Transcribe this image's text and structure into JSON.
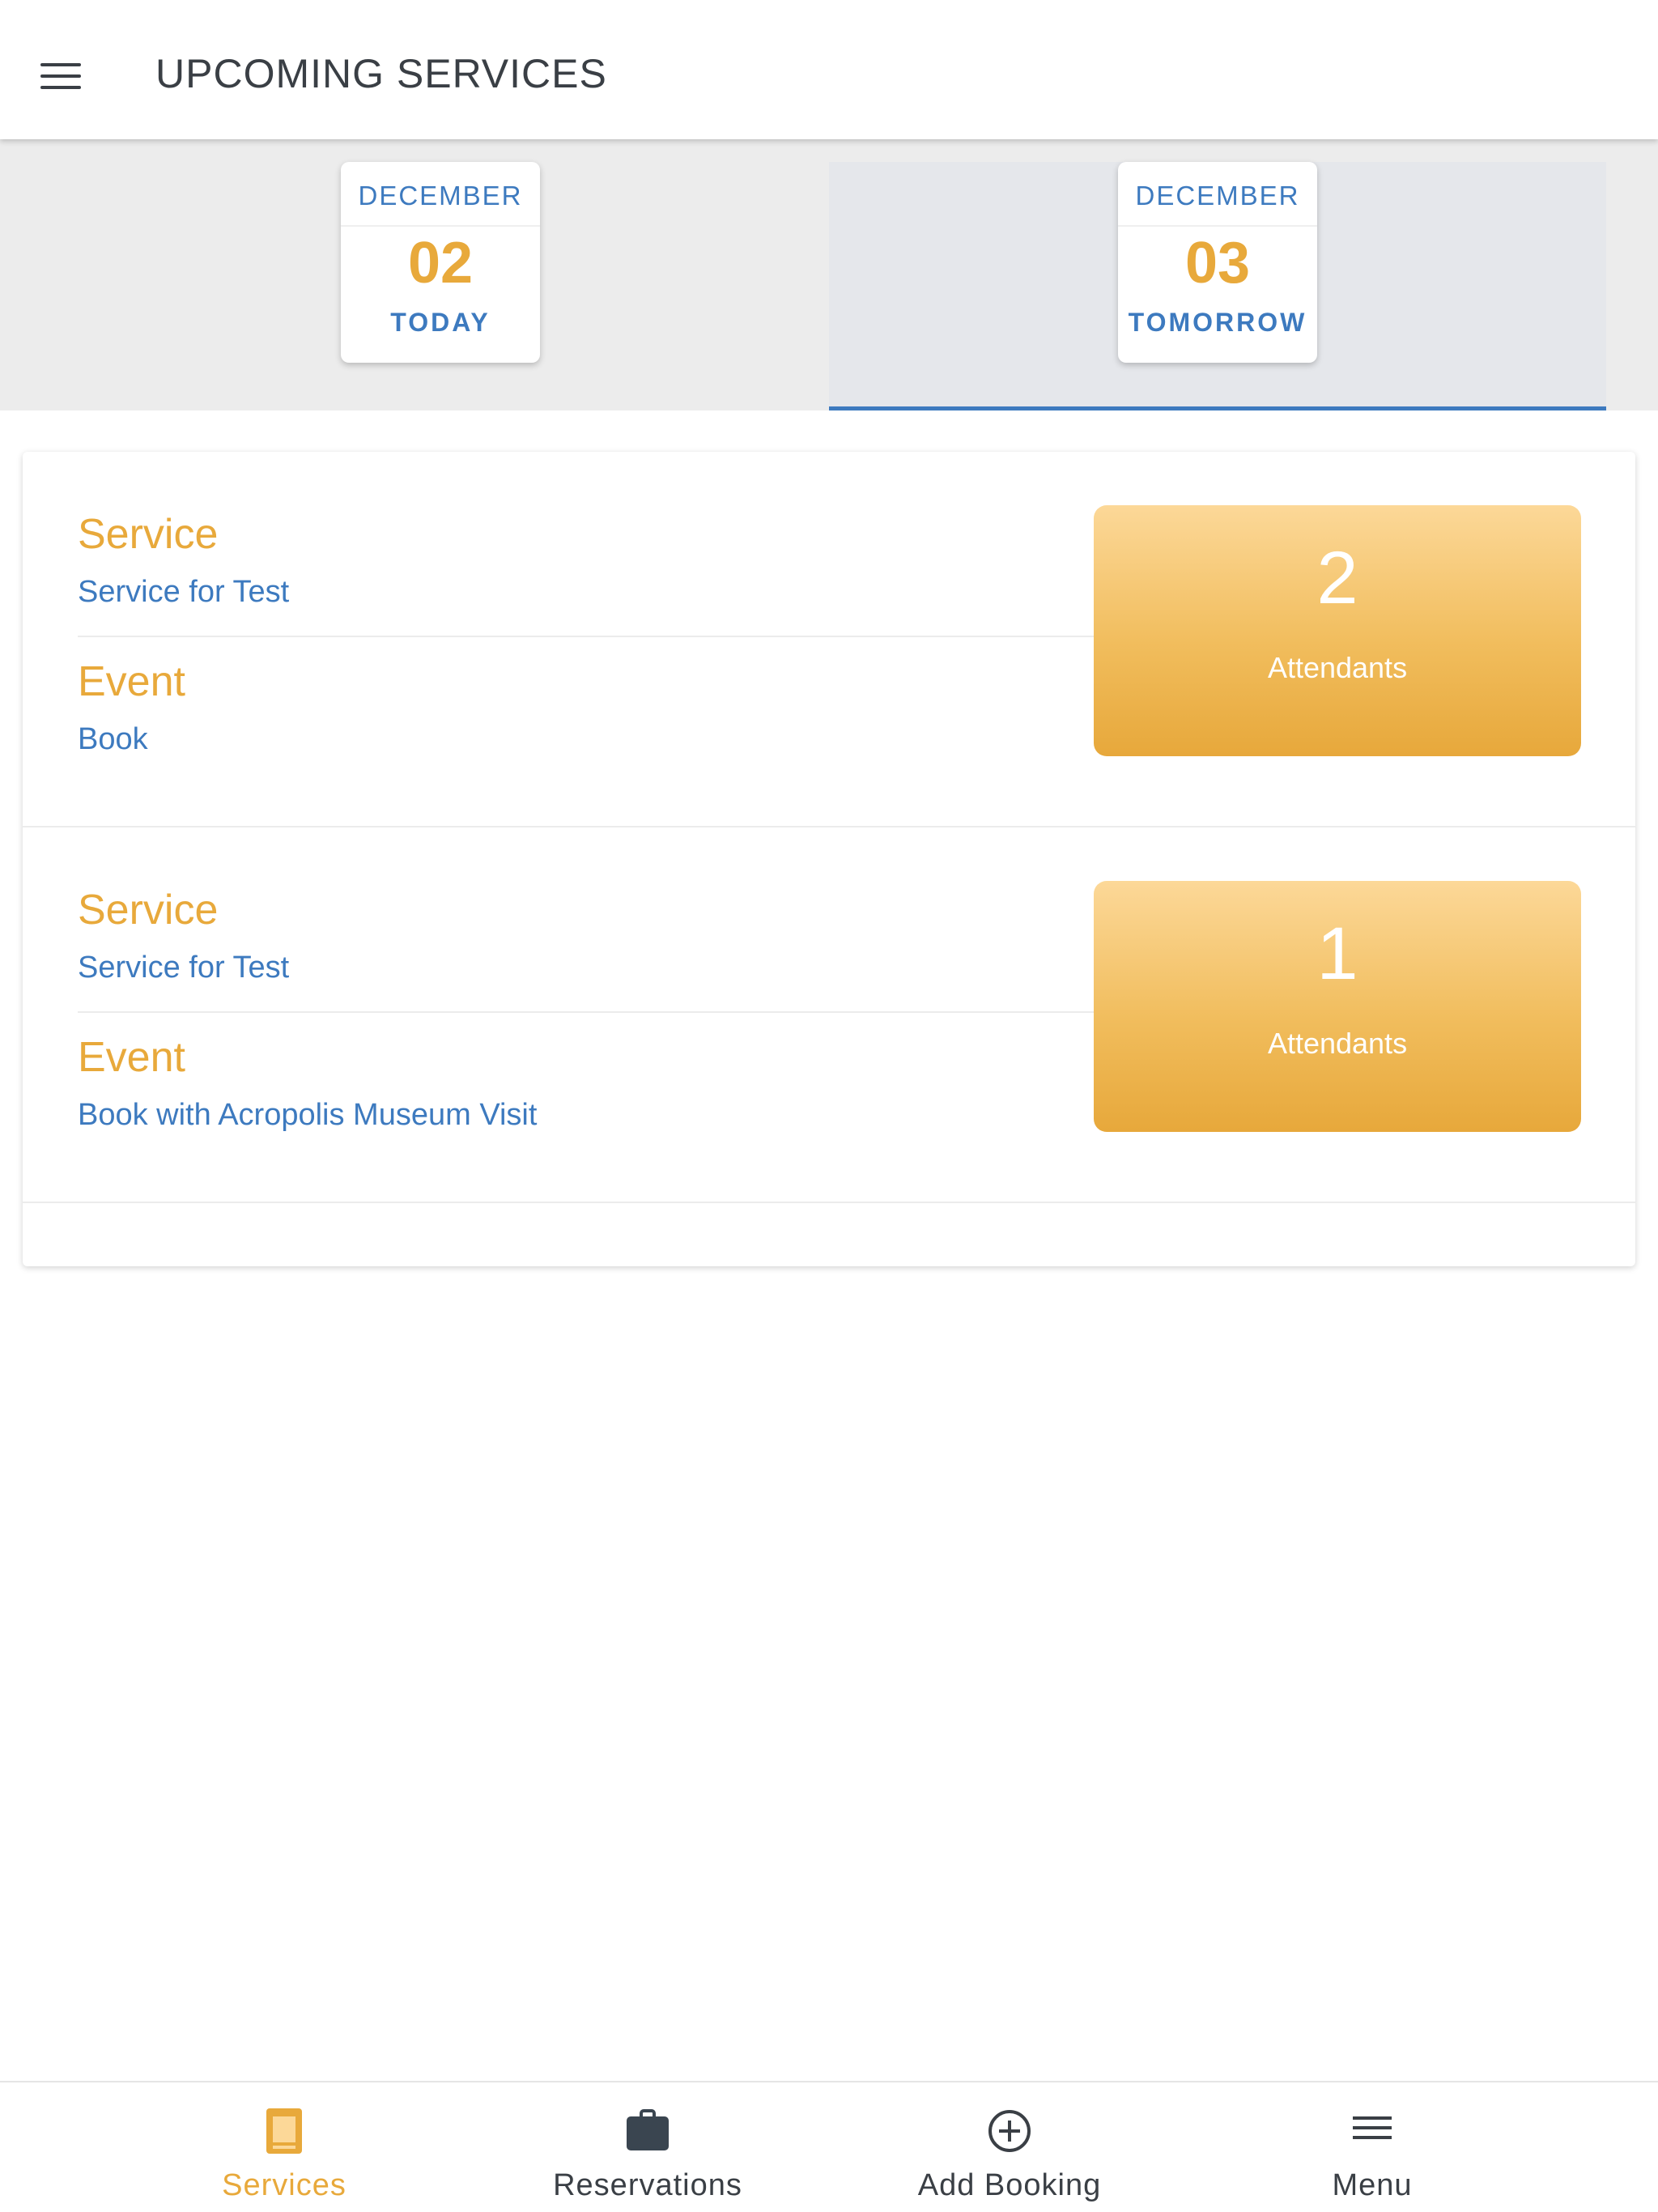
{
  "header": {
    "title": "UPCOMING SERVICES",
    "menu_icon": "hamburger-menu-icon"
  },
  "date_tabs": [
    {
      "month": "DECEMBER",
      "day": "02",
      "label": "TODAY",
      "selected": false
    },
    {
      "month": "DECEMBER",
      "day": "03",
      "label": "TOMORROW",
      "selected": true
    }
  ],
  "services": [
    {
      "service_label": "Service",
      "service_value": "Service for Test",
      "event_label": "Event",
      "event_value": "Book",
      "attendants_count": "2",
      "attendants_label": "Attendants"
    },
    {
      "service_label": "Service",
      "service_value": "Service for Test",
      "event_label": "Event",
      "event_value": "Book with Acropolis Museum Visit",
      "attendants_count": "1",
      "attendants_label": "Attendants"
    }
  ],
  "bottom_nav": [
    {
      "label": "Services",
      "icon": "services-doc-icon",
      "active": true
    },
    {
      "label": "Reservations",
      "icon": "briefcase-icon",
      "active": false
    },
    {
      "label": "Add Booking",
      "icon": "add-circle-icon",
      "active": false
    },
    {
      "label": "Menu",
      "icon": "menu-icon",
      "active": false
    }
  ],
  "colors": {
    "accent_orange": "#e8a93b",
    "accent_blue": "#3d7abf",
    "text_dark": "#3a3f45"
  }
}
